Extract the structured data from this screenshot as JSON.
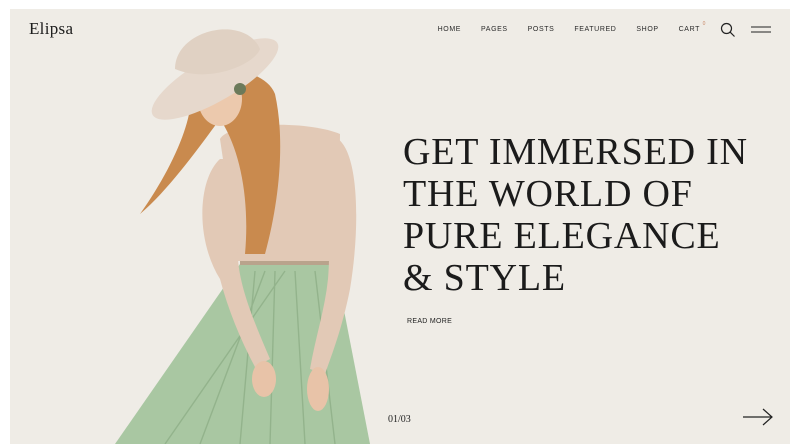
{
  "brand": {
    "logo": "Elipsa"
  },
  "nav": {
    "items": [
      "HOME",
      "PAGES",
      "POSTS",
      "FEATURED",
      "SHOP"
    ],
    "cart_label": "CART",
    "cart_count": "0"
  },
  "icons": {
    "search": "search-icon",
    "menu": "hamburger-menu-icon",
    "next": "arrow-right-icon"
  },
  "hero": {
    "headline_lines": [
      "GET IMMERSED IN",
      "THE WORLD OF",
      "PURE ELEGANCE",
      "& STYLE"
    ],
    "cta": "READ MORE",
    "slide_counter": "01/03"
  },
  "colors": {
    "background": "#efece6",
    "text": "#1b1b1b",
    "skirt": "#a9c7a2",
    "top": "#e2c9b6",
    "hat": "#e6d8cc",
    "hair": "#c98a4e",
    "accent": "#c98a6a"
  }
}
